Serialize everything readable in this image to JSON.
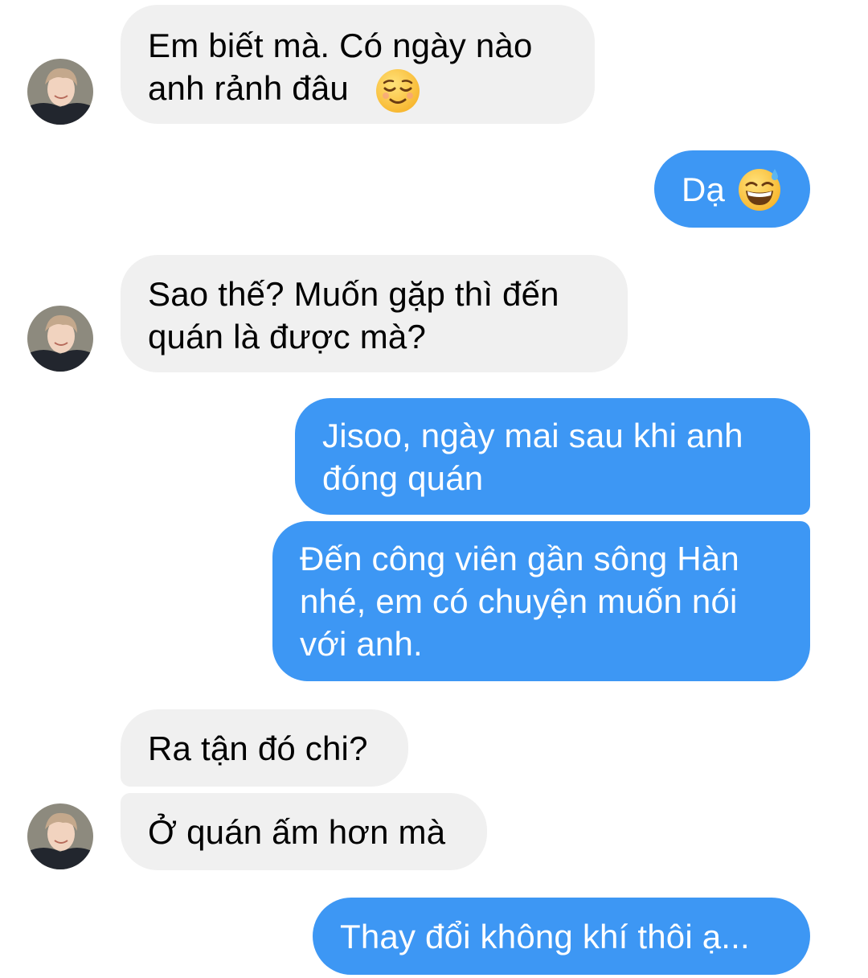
{
  "messages": [
    {
      "sender": "them",
      "text": "Em biết mà. Có ngày nào\nanh rảnh đâu",
      "emoji": "relieved-face"
    },
    {
      "sender": "me",
      "text": "Dạ",
      "emoji": "grinning-sweat-face"
    },
    {
      "sender": "them",
      "text": "Sao thế? Muốn gặp thì đến\nquán là được mà?"
    },
    {
      "sender": "me",
      "text": "Jisoo, ngày mai sau khi anh\nđóng quán"
    },
    {
      "sender": "me",
      "text": "Đến công viên gần sông Hàn\nnhé, em có chuyện muốn nói\nvới anh."
    },
    {
      "sender": "them",
      "text": "Ra tận đó chi?"
    },
    {
      "sender": "them",
      "text": "Ở quán ấm hơn mà"
    },
    {
      "sender": "me",
      "text": "Thay đổi không khí thôi ạ..."
    }
  ],
  "colors": {
    "incoming_bubble": "#f0f0f0",
    "outgoing_bubble": "#3d97f4",
    "incoming_text": "#000000",
    "outgoing_text": "#ffffff"
  }
}
